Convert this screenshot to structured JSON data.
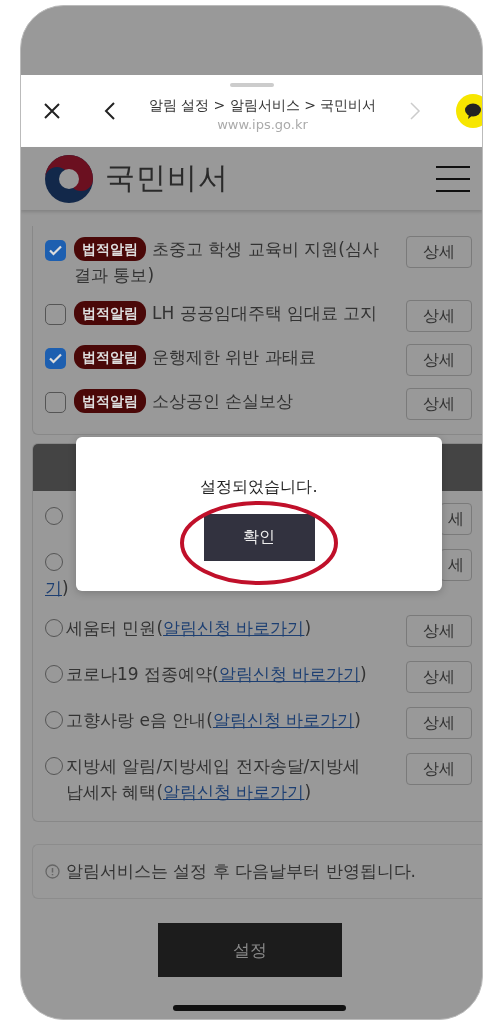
{
  "browser_sheet": {
    "title": "알림 설정 > 알림서비스 > 국민비서",
    "url": "www.ips.go.kr"
  },
  "header": {
    "brand": "국민비서"
  },
  "legal_alerts": [
    {
      "checked": true,
      "tag": "법적알림",
      "label": "초중고 학생 교육비 지원(심사 결과 통보)",
      "button": "상세"
    },
    {
      "checked": false,
      "tag": "법적알림",
      "label": "LH 공공임대주택 임대료 고지",
      "button": "상세"
    },
    {
      "checked": true,
      "tag": "법적알림",
      "label": "운행제한 위반 과태료",
      "button": "상세"
    },
    {
      "checked": false,
      "tag": "법적알림",
      "label": "소상공인 손실보상",
      "button": "상세"
    }
  ],
  "services": {
    "covered_items": [
      {
        "selected": false,
        "button": "세"
      },
      {
        "selected": false,
        "link": "기",
        "suffix": ")",
        "button": "세"
      }
    ],
    "items": [
      {
        "selected": false,
        "label": "세움터 민원(",
        "link": "알림신청 바로가기",
        "suffix": ")",
        "button": "상세"
      },
      {
        "selected": false,
        "label": "코로나19 접종예약(",
        "link": "알림신청 바로가기",
        "suffix": ")",
        "button": "상세"
      },
      {
        "selected": false,
        "label": "고향사랑 e음 안내(",
        "link": "알림신청 바로가기",
        "suffix": ")",
        "button": "상세"
      },
      {
        "selected": false,
        "label": "지방세 알림/지방세입 전자송달/지방세 납세자 혜택(",
        "link": "알림신청 바로가기",
        "suffix": ")",
        "button": "상세"
      }
    ]
  },
  "notice": "알림서비스는 설정 후 다음날부터 반영됩니다.",
  "submit_button": "설정",
  "dialog": {
    "message": "설정되었습니다.",
    "confirm": "확인"
  }
}
